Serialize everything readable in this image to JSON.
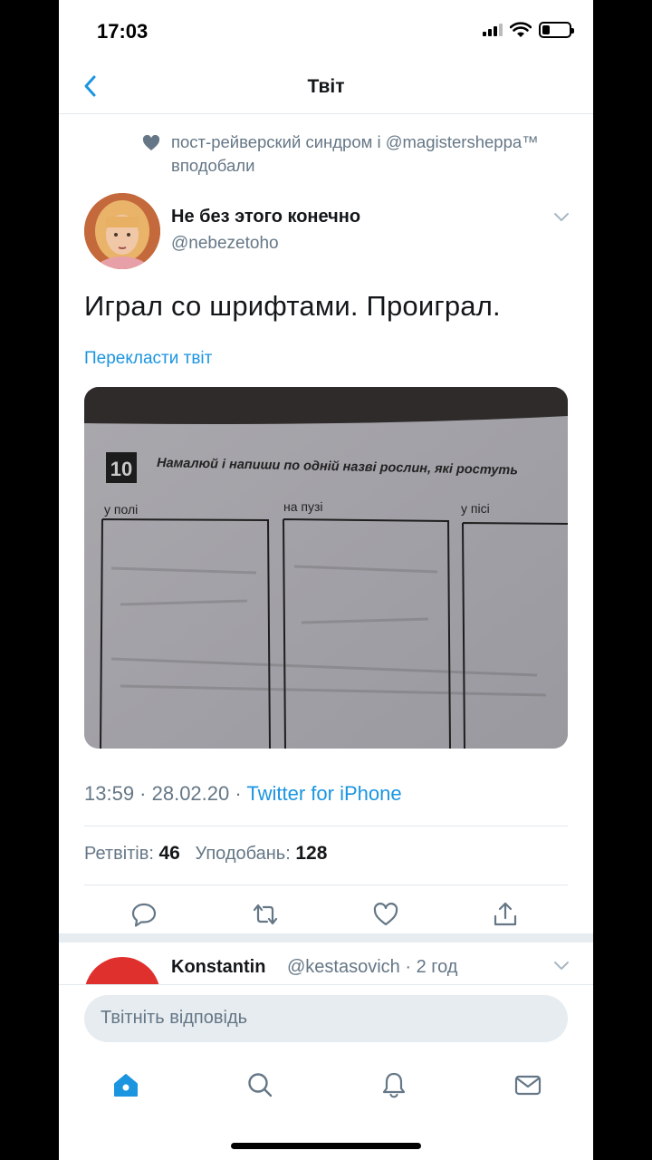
{
  "status_bar": {
    "time": "17:03"
  },
  "navbar": {
    "title": "Твіт"
  },
  "liked_by": {
    "text": "пост-рейверский синдром і @magistersheppa™ вподобали"
  },
  "tweet": {
    "author_name": "Не без этого конечно",
    "author_handle": "@nebezetoho",
    "text": "Играл со шрифтами. Проиграл.",
    "translate_link": "Перекласти твіт",
    "time": "13:59 · 28.02.20 · ",
    "source": "Twitter for iPhone",
    "retweets_label": "Ретвітів:",
    "retweets": "46",
    "likes_label": "Уподобань:",
    "likes": "128"
  },
  "photo": {
    "task_number": "10",
    "task_text": "Намалюй і напиши по одній назві рослин, які ростуть",
    "column_labels": [
      "у полі",
      "на пузі",
      "у пісі"
    ]
  },
  "reply_preview": {
    "name": "Konstantin",
    "meta": "@kestasovich · 2 год"
  },
  "composer": {
    "placeholder": "Твітніть відповідь"
  },
  "colors": {
    "accent": "#1b95e0",
    "text": "#14171a",
    "secondary": "#657786",
    "border": "#e1e8ed"
  },
  "icons": {
    "back": "chevron-left-icon",
    "liked": "heart-icon",
    "caret": "chevron-down-icon",
    "reply": "comment-icon",
    "retweet": "retweet-icon",
    "like": "heart-outline-icon",
    "share": "share-icon",
    "tab_home": "home-icon",
    "tab_search": "search-icon",
    "tab_notifications": "bell-icon",
    "tab_messages": "mail-icon"
  }
}
